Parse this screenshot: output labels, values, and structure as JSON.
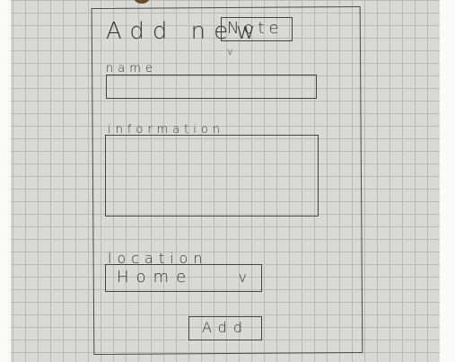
{
  "header": {
    "title": "Add new",
    "type_select": {
      "value": "Note",
      "chevron": "v"
    }
  },
  "form": {
    "name": {
      "label": "name",
      "value": ""
    },
    "information": {
      "label": "information",
      "value": ""
    },
    "location": {
      "label": "location",
      "value": "Home",
      "chevron": "v"
    },
    "submit_label": "Add"
  }
}
